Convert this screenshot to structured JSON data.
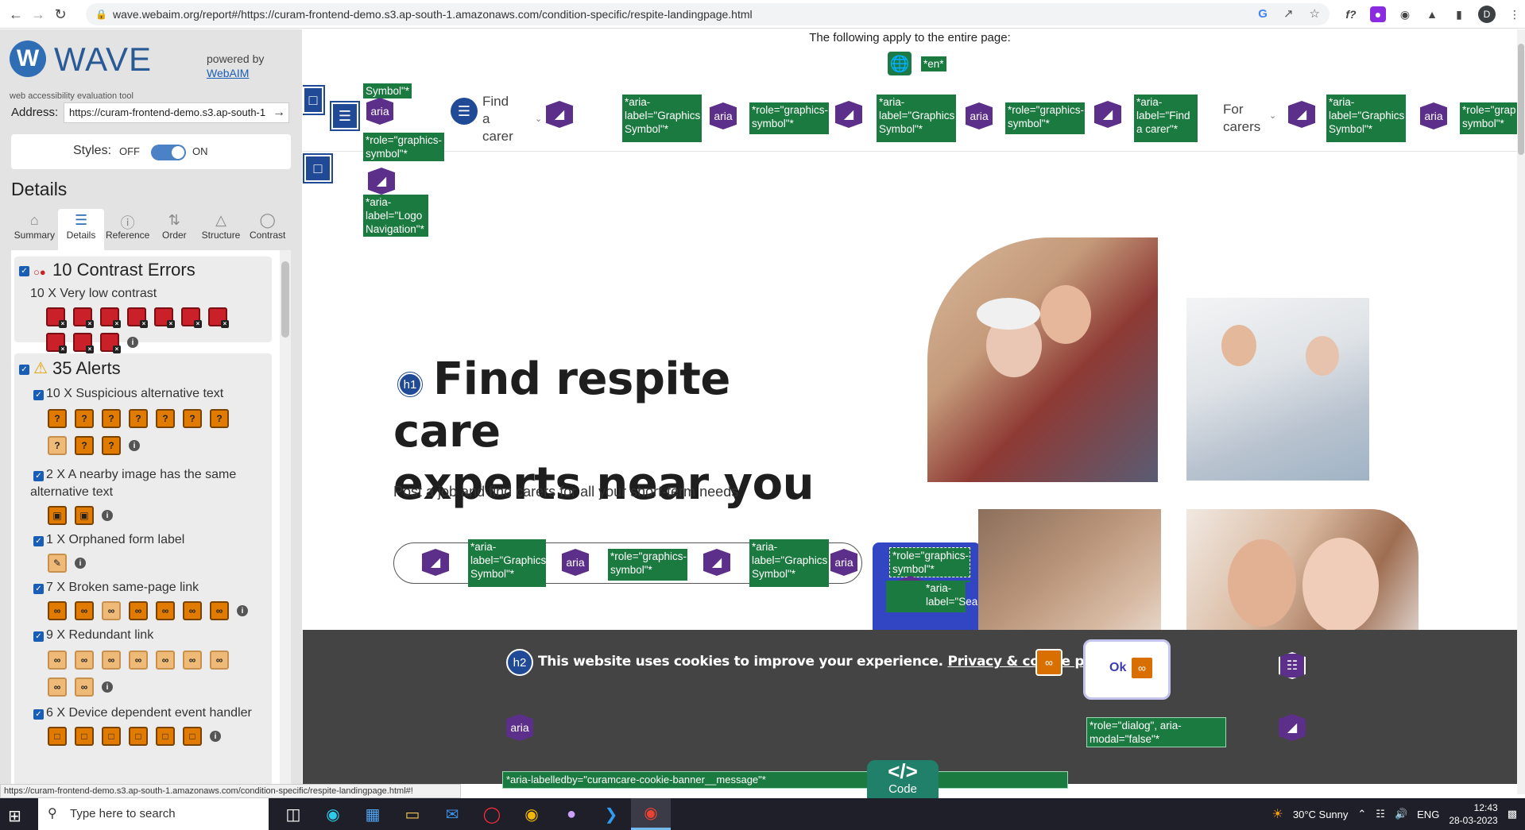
{
  "browser": {
    "url": "wave.webaim.org/report#/https://curam-frontend-demo.s3.ap-south-1.amazonaws.com/condition-specific/respite-landingpage.html",
    "profile_initial": "D"
  },
  "wave": {
    "title": "WAVE",
    "subtitle": "web accessibility evaluation tool",
    "powered_by": "powered by",
    "webaim_link": "WebAIM",
    "address_label": "Address:",
    "address_value": "https://curam-frontend-demo.s3.ap-south-1",
    "styles_label": "Styles:",
    "styles_off": "OFF",
    "styles_on": "ON",
    "details_heading": "Details",
    "tabs": [
      {
        "label": "Summary",
        "icon": "home-icon"
      },
      {
        "label": "Details",
        "icon": "list-icon"
      },
      {
        "label": "Reference",
        "icon": "info-icon"
      },
      {
        "label": "Order",
        "icon": "order-icon"
      },
      {
        "label": "Structure",
        "icon": "structure-icon"
      },
      {
        "label": "Contrast",
        "icon": "contrast-icon"
      }
    ],
    "active_tab": "Details",
    "contrast": {
      "title": "10 Contrast Errors",
      "items": [
        {
          "text": "10 X Very low contrast",
          "count": 10
        }
      ]
    },
    "alerts": {
      "title": "35 Alerts",
      "items": [
        {
          "text": "10 X Suspicious alternative text",
          "count": 10
        },
        {
          "text": "2 X A nearby image has the same",
          "text2": "alternative text",
          "count": 2
        },
        {
          "text": "1 X Orphaned form label",
          "count": 1
        },
        {
          "text": "7 X Broken same-page link",
          "count": 7
        },
        {
          "text": "9 X Redundant link",
          "count": 9
        },
        {
          "text": "6 X Device dependent event handler",
          "count": 6
        }
      ]
    },
    "statusbar": "https://curam-frontend-demo.s3.ap-south-1.amazonaws.com/condition-specific/respite-landingpage.html#!"
  },
  "page": {
    "applies_text": "The following apply to the entire page:",
    "lang_tag": "*en*",
    "nav": {
      "find_carer": [
        "Find",
        "a",
        "carer"
      ],
      "for_carers": [
        "For",
        "carers"
      ],
      "tags": {
        "symbol_top": "Symbol\"*",
        "aria": "aria",
        "role_graphics_lower": "*role=\"graphics-symbol\"*",
        "aria_label_logo": "*aria-label=\"Logo Navigation\"*",
        "aria_label_gs": "*aria-label=\"Graphics Symbol\"*",
        "role_gs": "*role=\"graphics-symbol\"*",
        "aria_label_find": "*aria-label=\"Find a carer\"*",
        "role_grap": "*role=\"grap symbol\"*"
      }
    },
    "hero": {
      "h1_badge": "h1",
      "title_line1": "Find respite care",
      "title_line2": "experts near you",
      "subtitle": "Post a job and find carers for all your short-term needs"
    },
    "search_tags": {
      "aria_label_gs": "*aria-label=\"Graphics Symbol\"*",
      "role_gs": "*role=\"graphics-symbol\"*",
      "role_gs2": "*role=\"graphics-symbol\"*",
      "aria_label_search": "*aria-label=\"Search\"*"
    },
    "cookie": {
      "h2_badge": "h2",
      "message": "This website uses cookies to improve your experience.",
      "link": "Privacy & cookie policy",
      "ok": "Ok",
      "role_dialog": "*role=\"dialog\", aria-modal=\"false\"*",
      "labelledby": "*aria-labelledby=\"curamcare-cookie-banner__message\"*"
    },
    "code_tab": "Code",
    "code_symbol": "</>"
  },
  "taskbar": {
    "search_placeholder": "Type here to search",
    "weather": "30°C  Sunny",
    "lang": "ENG",
    "time": "12:43",
    "date": "28-03-2023"
  },
  "colors": {
    "wave_blue": "#2f6db5",
    "error_red": "#c9202a",
    "alert_orange": "#e07b00",
    "aria_purple": "#5b2f8a",
    "tag_green": "#1b7a3f",
    "structure_blue": "#214a96"
  }
}
